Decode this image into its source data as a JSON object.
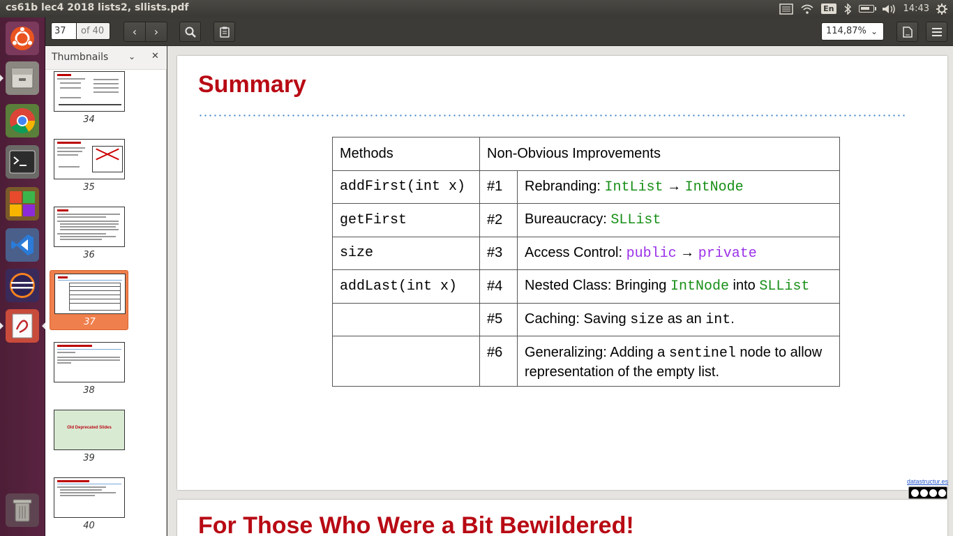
{
  "window": {
    "title": "cs61b lec4 2018 lists2, sllists.pdf"
  },
  "tray": {
    "keyboard": "En",
    "clock": "14:43",
    "battery_level": 0.75
  },
  "toolbar": {
    "page_current": "37",
    "page_total": "of 40",
    "zoom": "114,87%"
  },
  "sidebar": {
    "title": "Thumbnails",
    "thumbnails": [
      {
        "number": "34",
        "title": "Sentinel Node"
      },
      {
        "number": "35",
        "title": "addLast (with Sentinel Node)"
      },
      {
        "number": "36",
        "title": "Invariants"
      },
      {
        "number": "37",
        "title": "Summary",
        "selected": true
      },
      {
        "number": "38",
        "title": "For Those Who Were a Bit Bewildered"
      },
      {
        "number": "39",
        "title": "Old Deprecated Slides"
      },
      {
        "number": "40",
        "title": "Improvement #7: More Methods"
      }
    ]
  },
  "slide": {
    "title": "Summary",
    "table": {
      "headers": [
        "Methods",
        "Non-Obvious Improvements"
      ],
      "rows": [
        {
          "method": "addFirst(int x)",
          "num": "#1",
          "label": "Rebranding: ",
          "code1": "IntList",
          "sep": " → ",
          "code2": "IntNode",
          "after": ""
        },
        {
          "method": "getFirst",
          "num": "#2",
          "label": "Bureaucracy: ",
          "code1": "SLList",
          "sep": "",
          "code2": "",
          "after": ""
        },
        {
          "method": "size",
          "num": "#3",
          "label": "Access Control: ",
          "code1": "public",
          "sep": " → ",
          "code2": "private",
          "after": ""
        },
        {
          "method": "addLast(int x)",
          "num": "#4",
          "label": "Nested Class: Bringing ",
          "code1": "IntNode",
          "sep": " into ",
          "code2": "SLList",
          "after": ""
        },
        {
          "method": "",
          "num": "#5",
          "label": "Caching: Saving ",
          "code1": "size",
          "sep": " as an ",
          "code2": "int",
          "after": "."
        },
        {
          "method": "",
          "num": "#6",
          "label": "Generalizing: Adding a ",
          "code1": "sentinel",
          "sep": " node to allow representation of the empty list.",
          "code2": "",
          "after": ""
        }
      ]
    },
    "footer_link": "datastructur.es"
  },
  "next_slide": {
    "title": "For Those Who Were a Bit Bewildered!"
  },
  "colors": {
    "title_red": "#b80a14",
    "code_green": "#178f17",
    "code_purple": "#9b30e8",
    "selection_orange": "#ef7f4c",
    "launcher_purple": "#5a2341"
  },
  "launcher": [
    "ubuntu-dash-icon",
    "files-icon",
    "chrome-icon",
    "terminal-icon",
    "software-center-icon",
    "vscode-icon",
    "eclipse-icon",
    "document-viewer-icon",
    "trash-icon"
  ]
}
